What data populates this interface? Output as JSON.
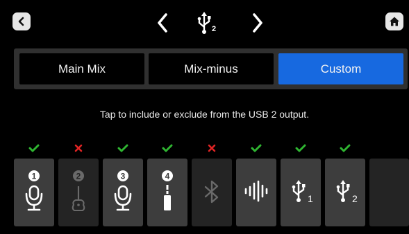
{
  "header": {
    "back": "back-icon",
    "prev": "chevron-left-icon",
    "title_icon": "usb-icon",
    "title_sub": "2",
    "next": "chevron-right-icon",
    "home": "home-icon"
  },
  "mix_modes": [
    {
      "label": "Main Mix",
      "active": false
    },
    {
      "label": "Mix-minus",
      "active": false
    },
    {
      "label": "Custom",
      "active": true
    }
  ],
  "instruction": "Tap to include or exclude from the USB 2 output.",
  "channels": [
    {
      "icon": "mic-icon",
      "number": "1",
      "included": true
    },
    {
      "icon": "guitar-icon",
      "number": "2",
      "included": false
    },
    {
      "icon": "mic-icon",
      "number": "3",
      "included": true
    },
    {
      "icon": "instrument-jack-icon",
      "number": "4",
      "included": true
    },
    {
      "icon": "bluetooth-icon",
      "number": "",
      "included": false
    },
    {
      "icon": "audio-waveform-icon",
      "number": "",
      "included": true
    },
    {
      "icon": "usb-icon",
      "number": "1",
      "included": true
    },
    {
      "icon": "usb-icon",
      "number": "2",
      "included": true
    },
    {
      "icon": "",
      "number": "",
      "included": null
    }
  ],
  "colors": {
    "accent": "#1769e0",
    "check": "#2fb531",
    "cross": "#e02424",
    "tile_on": "#3d3d3d",
    "tile_off": "#242424"
  }
}
